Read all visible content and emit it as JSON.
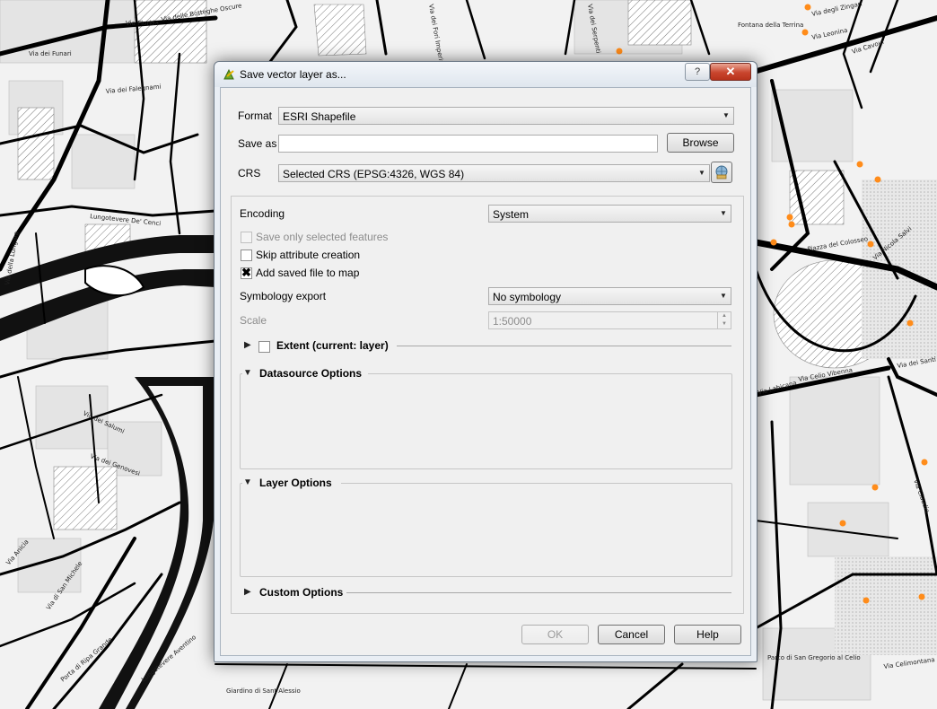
{
  "map": {
    "labels": [
      "Via Florida",
      "Via delle Botteghe Oscure",
      "Via dei Funari",
      "Via dei Fori Imperiali",
      "Lungotevere De' Cenci",
      "Via della Lungara",
      "Via dei Salumi",
      "Via dei Genovesi",
      "Via Anicia",
      "Via di San Michele",
      "Porta di Ripa Grande",
      "Lungotevere Aventino",
      "Piazza del Colosseo",
      "Via Nicola Salvi",
      "Via Celio Vibenna",
      "Via Claudia",
      "Via Cavour",
      "Via Leonina",
      "Via degli Zingari",
      "Via dei Santi Quattro",
      "Via Celimontana",
      "Parco di San Gregorio al Celio",
      "Giardino di Sant'Alessio",
      "Via Labicana",
      "Via dei Serpenti",
      "Fontana della Terrina",
      "Via dei Falegnami"
    ]
  },
  "dialog": {
    "title": "Save vector layer as...",
    "help_symbol": "?",
    "close_symbol": "✕",
    "format_label": "Format",
    "format_value": "ESRI Shapefile",
    "save_as_label": "Save as",
    "save_as_value": "",
    "browse_label": "Browse",
    "crs_label": "CRS",
    "crs_value": "Selected CRS (EPSG:4326, WGS 84)",
    "encoding_label": "Encoding",
    "encoding_value": "System",
    "save_selected_label": "Save only selected features",
    "save_selected_checked": false,
    "skip_attr_label": "Skip attribute creation",
    "skip_attr_checked": false,
    "add_to_map_label": "Add saved file to map",
    "add_to_map_checked": true,
    "check_mark": "✖",
    "symbology_label": "Symbology export",
    "symbology_value": "No symbology",
    "scale_label": "Scale",
    "scale_value": "1:50000",
    "extent_label": "Extent (current: layer)",
    "datasource_label": "Datasource Options",
    "layer_options_label": "Layer Options",
    "custom_options_label": "Custom Options",
    "ok_label": "OK",
    "cancel_label": "Cancel",
    "help_label": "Help",
    "dropdown_arrow": "▼",
    "spin_up": "▲",
    "spin_down": "▼",
    "collapsed_arrow": "▶",
    "expanded_arrow": "▼"
  }
}
